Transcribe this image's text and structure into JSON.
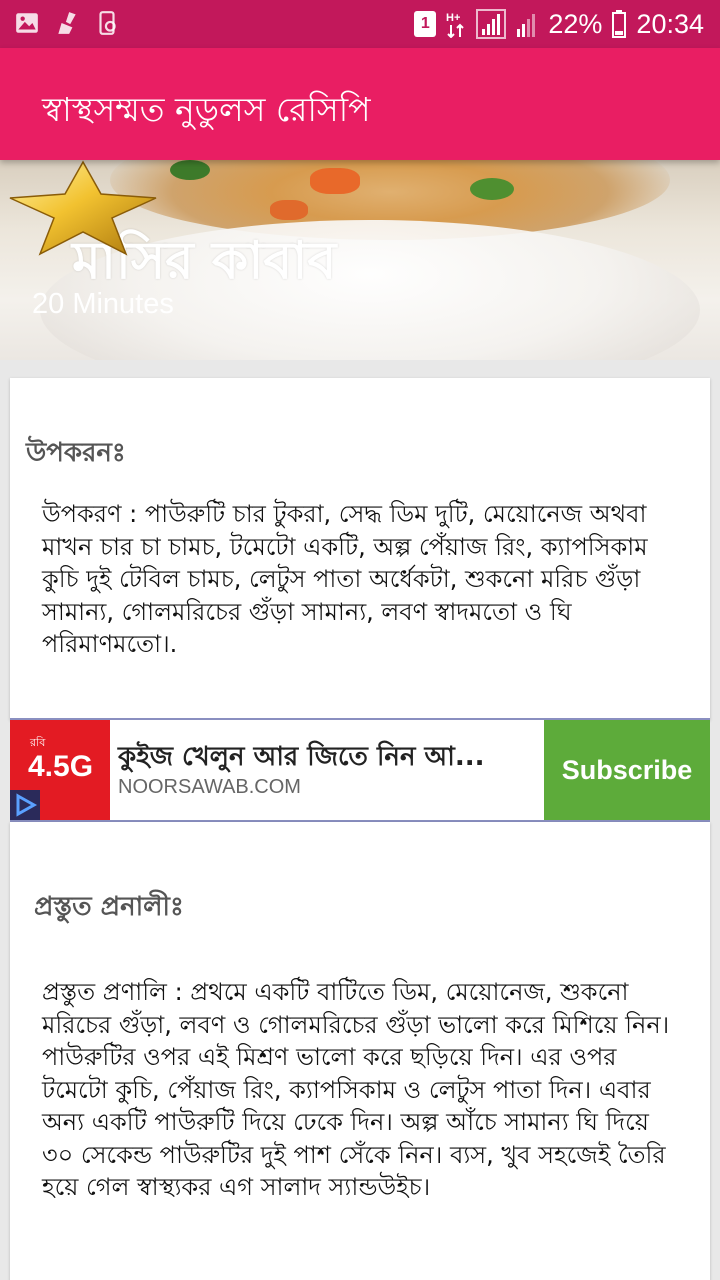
{
  "status_bar": {
    "sim_slot": "1",
    "network_type": "H+",
    "battery": "22%",
    "time": "20:34",
    "icons": [
      "gallery-icon",
      "cleaner-icon",
      "phone-settings-icon",
      "sim-icon",
      "data-arrows-icon",
      "signal-icon",
      "battery-icon"
    ]
  },
  "toolbar": {
    "title": "স্বাস্থসম্মত নুডুলস রেসিপি"
  },
  "hero": {
    "title": "মাসির কাবাব",
    "time": "20 Minutes",
    "badge_icon": "gold-star-icon"
  },
  "ingredients": {
    "heading": "উপকরনঃ",
    "text": " উপকরণ : পাউরুটি চার টুকরা, সেদ্ধ ডিম দুটি, মেয়োনেজ অথবা মাখন চার চা চামচ, টমেটো একটি, অল্প পেঁয়াজ রিং, ক্যাপসিকাম কুচি দুই টেবিল চামচ, লেটুস পাতা অর্ধেকটা, শুকনো মরিচ গুঁড়া সামান্য, গোলমরিচের গুঁড়া সামান্য, লবণ স্বাদমতো ও ঘি পরিমাণমতো।."
  },
  "ad": {
    "logo_text": "4.5G",
    "logo_sub": "রবি",
    "title": "কুইজ খেলুন আর জিতে নিন আ...",
    "url": "NOORSAWAB.COM",
    "button": "Subscribe",
    "colors": {
      "logo_bg": "#e31b23",
      "button_bg": "#5dab3a"
    }
  },
  "method": {
    "heading": "প্রস্তুত প্রনালীঃ",
    "text": "প্রস্তুত প্রণালি : প্রথমে একটি বাটিতে ডিম, মেয়োনেজ, শুকনো মরিচের গুঁড়া, লবণ ও গোলমরিচের গুঁড়া ভালো করে মিশিয়ে নিন। পাউরুটির ওপর এই মিশ্রণ ভালো করে ছড়িয়ে দিন। এর ওপর টমেটো কুচি, পেঁয়াজ রিং, ক্যাপসিকাম ও লেটুস পাতা দিন। এবার অন্য একটি পাউরুটি দিয়ে ঢেকে দিন। অল্প আঁচে সামান্য ঘি দিয়ে ৩০ সেকেন্ড পাউরুটির দুই পাশ সেঁকে নিন। ব্যস, খুব সহজেই তৈরি হয়ে গেল স্বাস্থ্যকর এগ সালাদ স্যান্ডউইচ।"
  },
  "theme": {
    "status_bar": "#c2185b",
    "toolbar": "#e91e63"
  }
}
